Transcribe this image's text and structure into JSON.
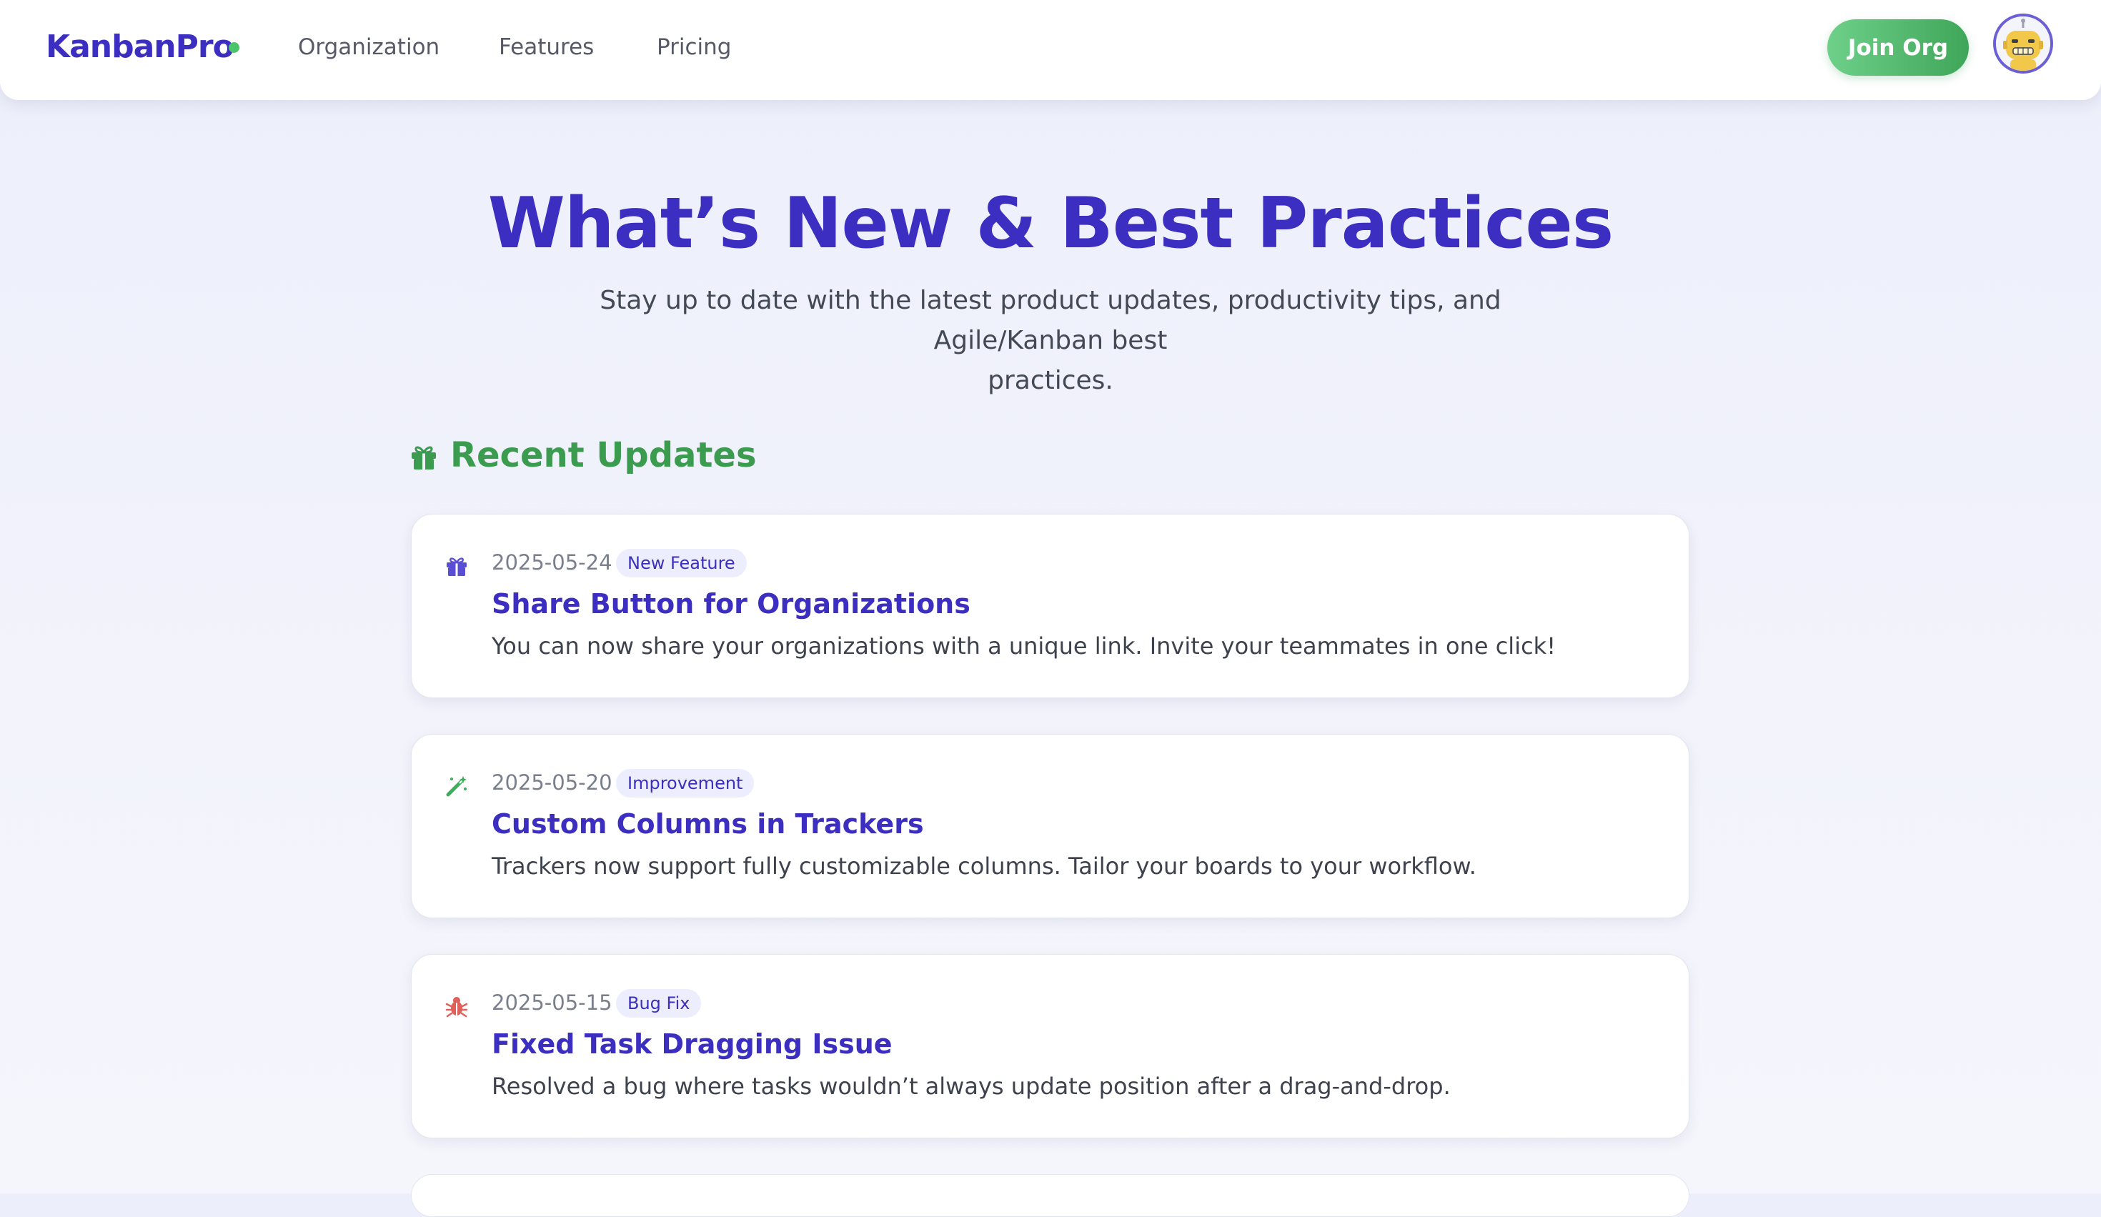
{
  "nav": {
    "logo": "KanbanPro",
    "links": [
      "Organization",
      "Features",
      "Pricing"
    ],
    "join_label": "Join Org",
    "avatar_icon": "robot-avatar-icon"
  },
  "hero": {
    "title": "What’s New & Best Practices",
    "subtitle_line1": "Stay up to date with the latest product updates, productivity tips, and Agile/Kanban best",
    "subtitle_line2": "practices."
  },
  "updates": {
    "title": "Recent Updates",
    "icon": "gift-icon",
    "items": [
      {
        "date": "2025-05-24",
        "badge": "New Feature",
        "title": "Share Button for Organizations",
        "description": "You can now share your organizations with a unique link. Invite your teammates in one click!",
        "icon": "gift-icon",
        "icon_color": "#5a4fd4"
      },
      {
        "date": "2025-05-20",
        "badge": "Improvement",
        "title": "Custom Columns in Trackers",
        "description": "Trackers now support fully customizable columns. Tailor your boards to your workflow.",
        "icon": "magic-wand-icon",
        "icon_color": "#3fae5a"
      },
      {
        "date": "2025-05-15",
        "badge": "Bug Fix",
        "title": "Fixed Task Dragging Issue",
        "description": "Resolved a bug where tasks wouldn’t always update position after a drag-and-drop.",
        "icon": "bug-icon",
        "icon_color": "#e0605a"
      }
    ]
  },
  "colors": {
    "brand": "#3b2ec0",
    "accent_green": "#3fa659",
    "badge_bg": "#eceefd"
  }
}
